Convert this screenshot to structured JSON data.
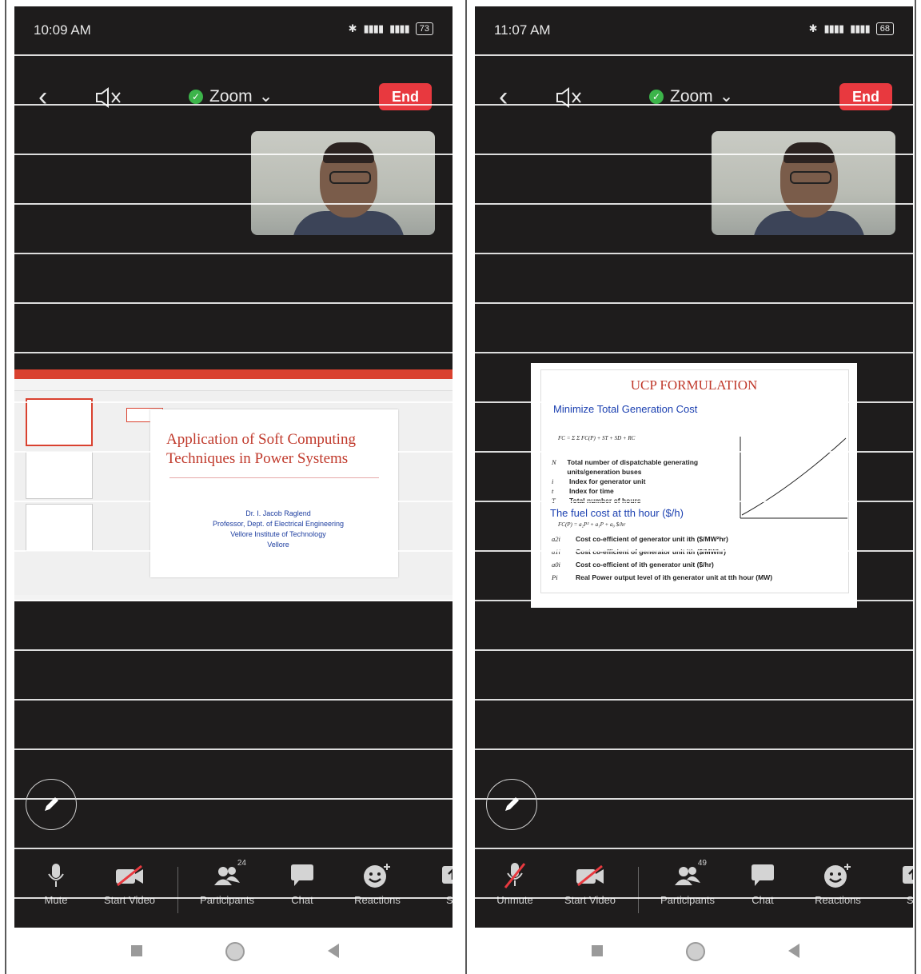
{
  "left": {
    "status": {
      "time": "10:09 AM",
      "battery": "73"
    },
    "topbar": {
      "title": "Zoom",
      "end_label": "End"
    },
    "presentation": {
      "title": "Application of Soft Computing Techniques in Power Systems",
      "author": "Dr. I. Jacob Raglend",
      "position": "Professor, Dept. of Electrical Engineering",
      "institute": "Vellore Institute of Technology",
      "city": "Vellore"
    },
    "toolbar": {
      "mute_label": "Mute",
      "video_label": "Start Video",
      "participants_label": "Participants",
      "participants_count": "24",
      "chat_label": "Chat",
      "reactions_label": "Reactions",
      "share_label": "Sh"
    }
  },
  "right": {
    "status": {
      "time": "11:07 AM",
      "battery": "68"
    },
    "topbar": {
      "title": "Zoom",
      "end_label": "End"
    },
    "slide": {
      "title": "UCP FORMULATION",
      "subtitle": "Minimize Total Generation Cost",
      "defs": [
        {
          "sym": "N",
          "text": "Total number of dispatchable generating units/generation buses"
        },
        {
          "sym": "i",
          "text": "Index for generator unit"
        },
        {
          "sym": "t",
          "text": "Index for time"
        },
        {
          "sym": "T",
          "text": "Total number of hours"
        }
      ],
      "fuel_cost": "The fuel cost at tth hour ($/h)",
      "coefs": [
        {
          "sym": "a2i",
          "text": "Cost co-efficient of generator unit ith ($/MW²hr)"
        },
        {
          "sym": "a1i",
          "text": "Cost co-efficient of generator unit ith ($/MWhr)"
        },
        {
          "sym": "a0i",
          "text": "Cost co-efficient of ith generator unit ($/hr)"
        },
        {
          "sym": "Pi",
          "text": "Real Power output level of ith generator unit at tth hour (MW)"
        }
      ]
    },
    "toolbar": {
      "mute_label": "Unmute",
      "video_label": "Start Video",
      "participants_label": "Participants",
      "participants_count": "49",
      "chat_label": "Chat",
      "reactions_label": "Reactions",
      "share_label": "Sh"
    }
  },
  "colors": {
    "end_button": "#e8393f",
    "slide_title": "#c0392b",
    "slide_blue": "#1a3fb0",
    "call_bg": "#1e1c1c"
  },
  "icons": [
    "back-icon",
    "speaker-off-icon",
    "shield-check-icon",
    "chevron-down-icon",
    "pencil-icon",
    "microphone-icon",
    "video-off-icon",
    "participants-icon",
    "chat-icon",
    "reactions-icon",
    "share-icon"
  ]
}
